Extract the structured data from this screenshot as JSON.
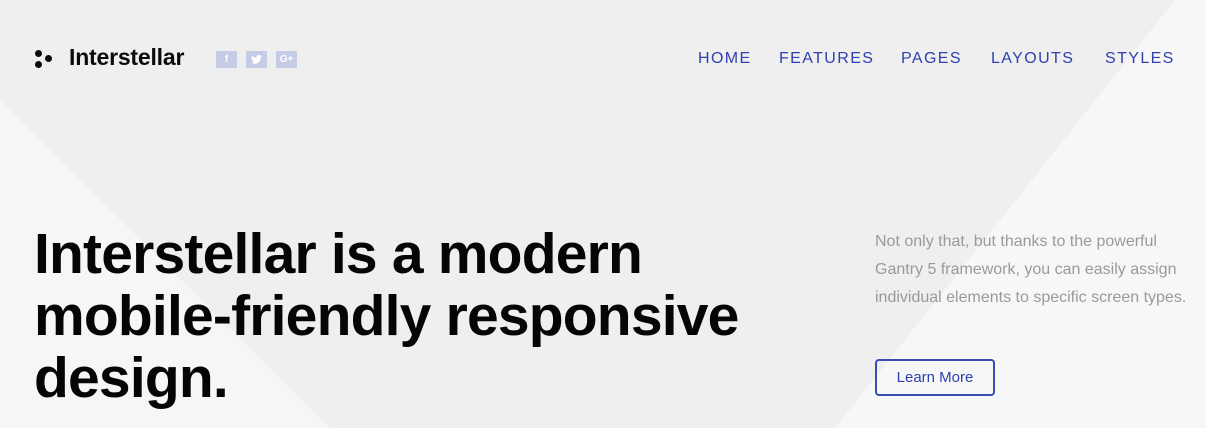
{
  "brand": {
    "name": "Interstellar",
    "logo_icon": "three-dots-logo-icon"
  },
  "social": [
    {
      "icon": "facebook-icon",
      "glyph": "f"
    },
    {
      "icon": "twitter-icon",
      "glyph": ""
    },
    {
      "icon": "google-plus-icon",
      "glyph": "G+"
    }
  ],
  "nav": {
    "items": [
      {
        "label": "HOME"
      },
      {
        "label": "FEATURES"
      },
      {
        "label": "PAGES"
      },
      {
        "label": "LAYOUTS"
      },
      {
        "label": "STYLES"
      }
    ]
  },
  "hero": {
    "headline": "Interstellar is a modern mobile-friendly responsive design.",
    "description": "Not only that, but thanks to the powerful Gantry 5 framework, you can easily assign individual elements to specific screen types.",
    "cta_label": "Learn More"
  },
  "colors": {
    "accent": "#2f40b1",
    "background": "#efeff0",
    "social_icon_bg": "#c7cce6"
  }
}
